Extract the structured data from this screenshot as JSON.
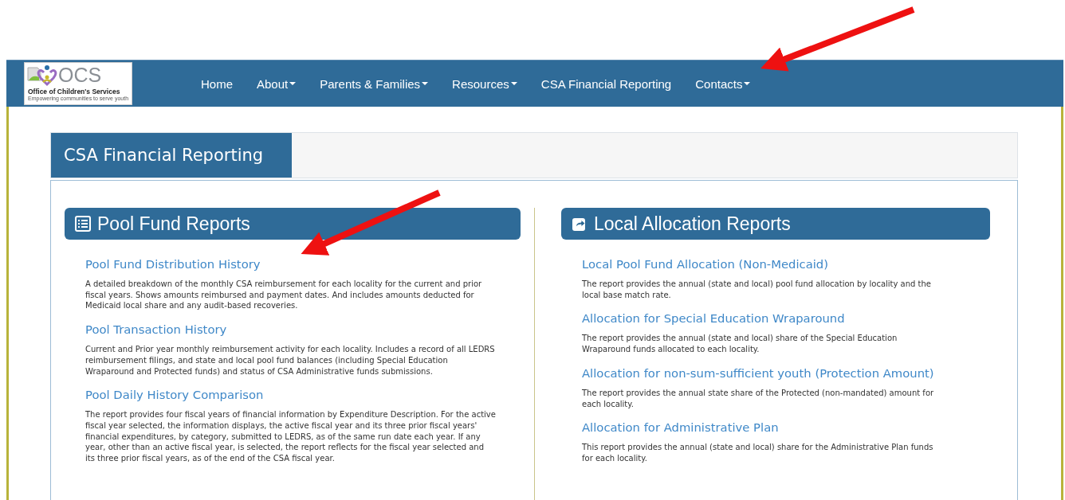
{
  "logo": {
    "wordmark": "OCS",
    "name": "Office of Children's Services",
    "tagline": "Empowering communities to serve youth"
  },
  "nav": [
    {
      "label": "Home",
      "dropdown": false
    },
    {
      "label": "About",
      "dropdown": true
    },
    {
      "label": "Parents & Families",
      "dropdown": true
    },
    {
      "label": "Resources",
      "dropdown": true
    },
    {
      "label": "CSA Financial Reporting",
      "dropdown": false
    },
    {
      "label": "Contacts",
      "dropdown": true
    }
  ],
  "page_title": "CSA Financial Reporting",
  "sections": [
    {
      "title": "Pool Fund Reports",
      "reports": [
        {
          "link": "Pool Fund Distribution History",
          "description": "A detailed breakdown of the monthly CSA reimbursement for each locality for the current and prior fiscal years. Shows amounts reimbursed and payment dates. And includes amounts deducted for Medicaid local share and any audit-based recoveries."
        },
        {
          "link": "Pool Transaction History",
          "description": "Current and Prior year monthly reimbursement activity for each locality. Includes a record of all LEDRS reimbursement filings, and state and local pool fund balances (including Special Education Wraparound and Protected funds) and status of CSA Administrative funds submissions."
        },
        {
          "link": "Pool Daily History Comparison",
          "description": "The report provides four fiscal years of financial information by Expenditure Description. For the active fiscal year selected, the information displays, the active fiscal year and its three prior fiscal years' financial expenditures, by category, submitted to LEDRS, as of the same run date each year. If any year, other than an active fiscal year, is selected, the report reflects for the fiscal year selected and its three prior fiscal years, as of the end of the CSA fiscal year."
        }
      ]
    },
    {
      "title": "Local Allocation Reports",
      "reports": [
        {
          "link": "Local Pool Fund Allocation (Non-Medicaid)",
          "description": "The report provides the annual (state and local) pool fund allocation by locality and the local base match rate."
        },
        {
          "link": "Allocation for Special Education Wraparound",
          "description": "The report provides the annual (state and local) share of the Special Education Wraparound funds allocated to each locality."
        },
        {
          "link": "Allocation for non-sum-sufficient youth (Protection Amount)",
          "description": "The report provides the annual state share of the Protected (non-mandated) amount for each locality."
        },
        {
          "link": "Allocation for Administrative Plan",
          "description": "This report provides the annual (state and local) share for the Administrative Plan funds for each locality."
        }
      ]
    }
  ]
}
